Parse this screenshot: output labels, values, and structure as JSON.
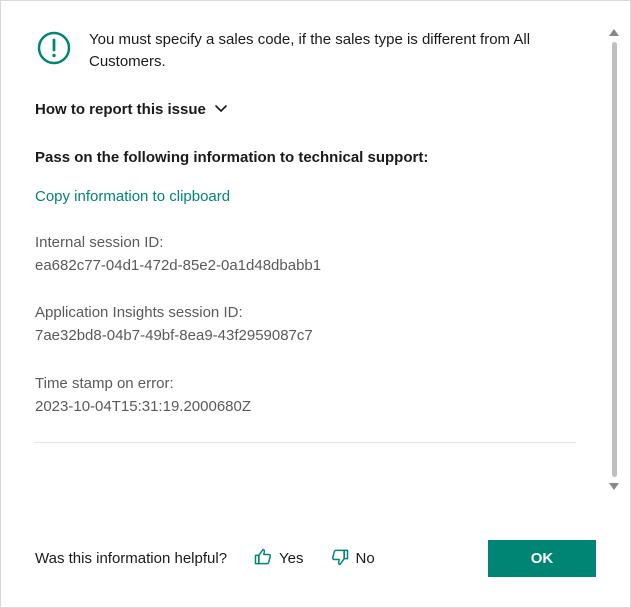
{
  "message": "You must specify a sales code, if the sales type is different from All Customers.",
  "howto_label": "How to report this issue",
  "pass_on_heading": "Pass on the following information to technical support:",
  "copy_link": "Copy information to clipboard",
  "info": {
    "session_label": "Internal session ID:",
    "session_value": "ea682c77-04d1-472d-85e2-0a1d48dbabb1",
    "ai_label": "Application Insights session ID:",
    "ai_value": "7ae32bd8-04b7-49bf-8ea9-43f2959087c7",
    "ts_label": "Time stamp on error:",
    "ts_value": "2023-10-04T15:31:19.2000680Z"
  },
  "footer": {
    "helpful_question": "Was this information helpful?",
    "yes_label": "Yes",
    "no_label": "No",
    "ok_label": "OK"
  },
  "colors": {
    "accent": "#008575"
  }
}
